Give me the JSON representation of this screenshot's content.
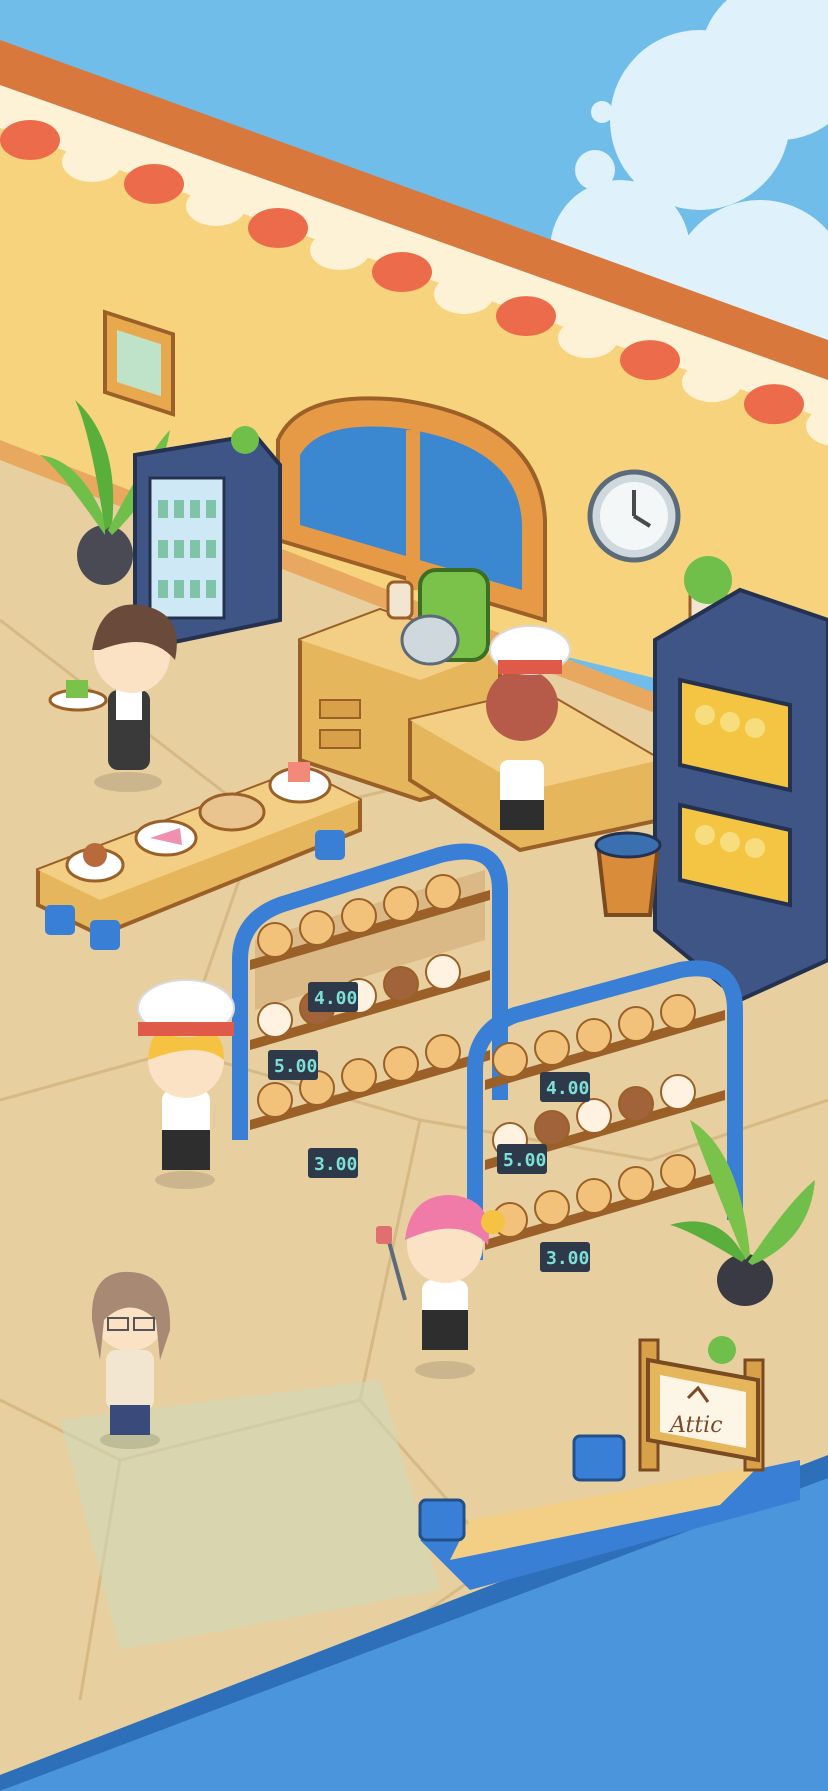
{
  "game": {
    "scene": "bakery-interior",
    "price_tags": {
      "rack_left": {
        "top": "4.00",
        "middle": "5.00",
        "bottom": "3.00"
      },
      "rack_right": {
        "top": "4.00",
        "middle": "5.00",
        "bottom": "3.00"
      }
    },
    "attic_sign": {
      "label": "Attic",
      "icon": "up-arrow-house-icon"
    },
    "characters": [
      {
        "role": "waiter",
        "name": "waiter-with-tray"
      },
      {
        "role": "chef-at-counter",
        "name": "chef-at-counter"
      },
      {
        "role": "chef-front",
        "name": "chef-front"
      },
      {
        "role": "customer-selfie",
        "name": "customer-selfie"
      },
      {
        "role": "customer-phone",
        "name": "customer-phone"
      }
    ],
    "colors": {
      "sky": "#6fbde8",
      "wall": "#f7d37e",
      "floor": "#e8cfa0",
      "awning_red": "#ec6b4b",
      "awning_cream": "#fdf1d6",
      "rack_blue": "#3a7fd6",
      "oven_navy": "#3f5585"
    }
  }
}
